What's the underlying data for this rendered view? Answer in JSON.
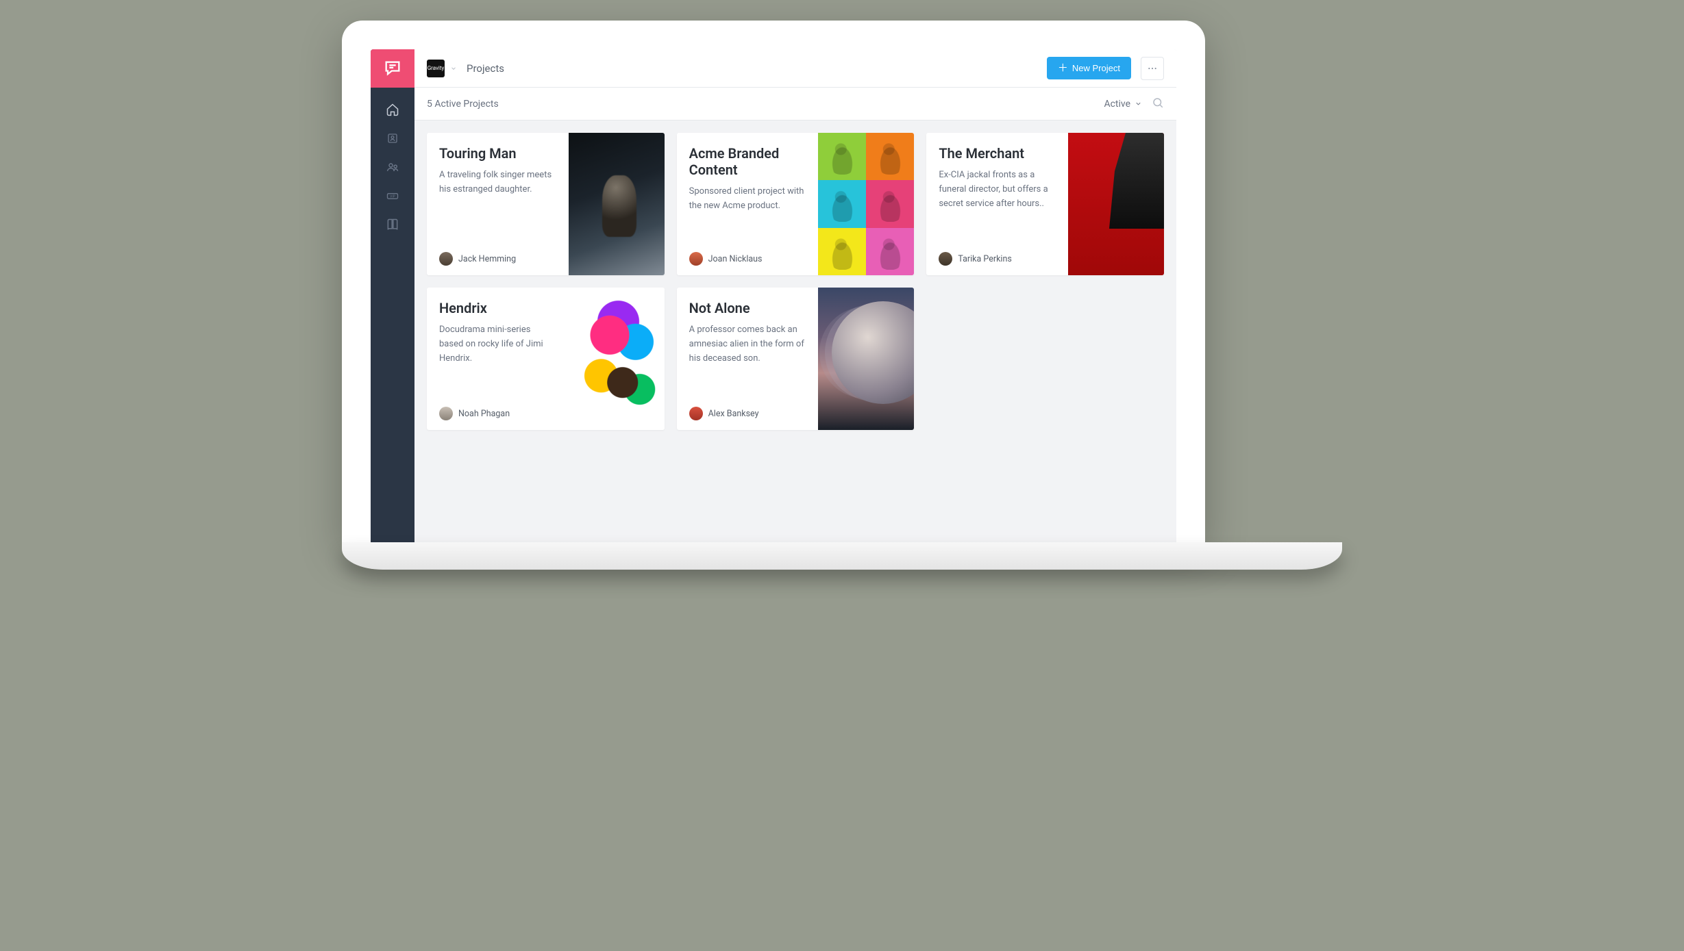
{
  "workspace": {
    "chip_label": "Gravity"
  },
  "breadcrumb": "Projects",
  "actions": {
    "new_project_label": "New Project"
  },
  "subbar": {
    "count_label": "5 Active Projects",
    "filter_label": "Active"
  },
  "projects": [
    {
      "title": "Touring Man",
      "desc": "A traveling folk singer meets his estranged daughter.",
      "author": "Jack Hemming"
    },
    {
      "title": "Acme Branded Content",
      "desc": "Sponsored client project with the new Acme product.",
      "author": "Joan Nicklaus"
    },
    {
      "title": "The Merchant",
      "desc": "Ex-CIA jackal fronts as a funeral director, but offers a secret service after hours..",
      "author": "Tarika Perkins"
    },
    {
      "title": "Hendrix",
      "desc": "Docudrama mini-series based on rocky life of Jimi Hendrix.",
      "author": "Noah Phagan"
    },
    {
      "title": "Not Alone",
      "desc": "A professor comes back an amnesiac alien in the form of his deceased son.",
      "author": "Alex Banksey"
    }
  ]
}
